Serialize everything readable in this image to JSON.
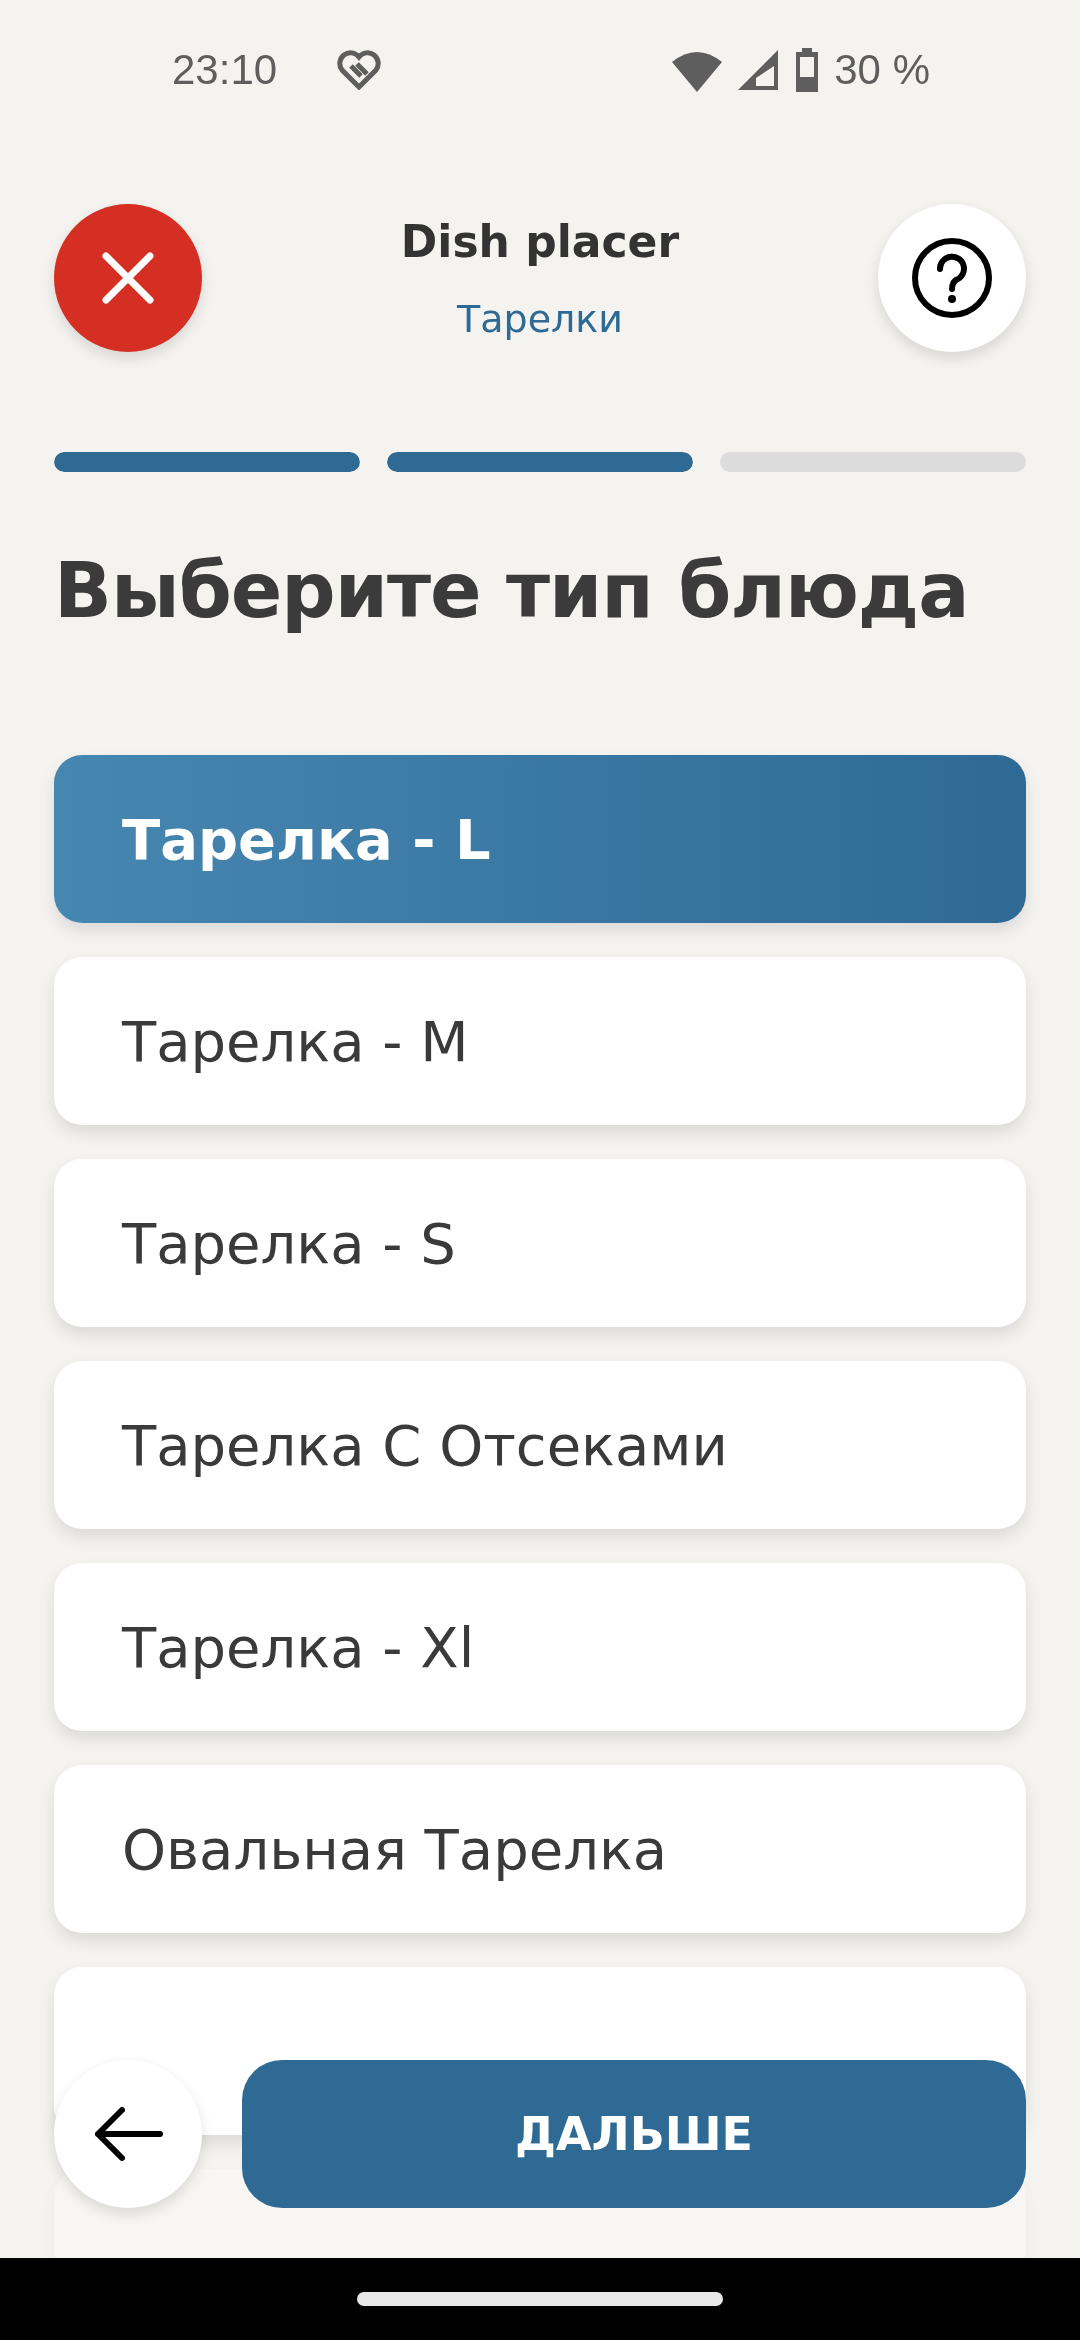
{
  "status_bar": {
    "time": "23:10",
    "battery": "30 %"
  },
  "header": {
    "title": "Dish placer",
    "subtitle": "Тарелки"
  },
  "progress": [
    {
      "level": 1
    },
    {
      "level": 1
    },
    {
      "level": 0
    }
  ],
  "heading": "Выберите тип блюда",
  "options": [
    {
      "label": "Тарелка - L",
      "selected": true
    },
    {
      "label": "Тарелка - M",
      "selected": false
    },
    {
      "label": "Тарелка - S",
      "selected": false
    },
    {
      "label": "Тарелка С Отсеками",
      "selected": false
    },
    {
      "label": "Тарелка - Xl",
      "selected": false
    },
    {
      "label": "Овальная Тарелка",
      "selected": false
    }
  ],
  "next_button": "ДАЛЬШЕ"
}
